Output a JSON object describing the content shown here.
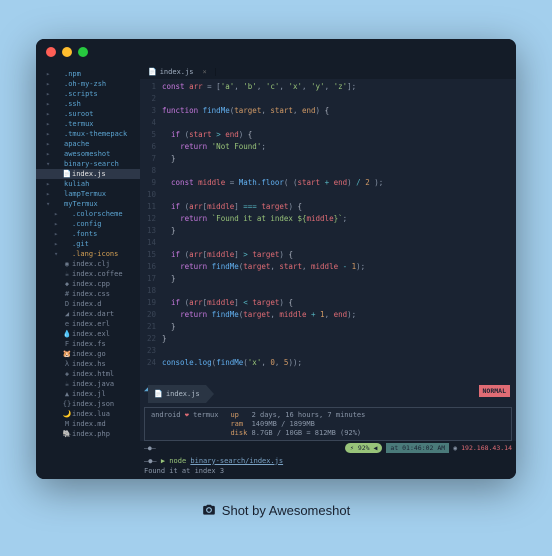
{
  "tab": {
    "icon": "📄",
    "filename": "index.js",
    "close": "×"
  },
  "sidebar": {
    "items": [
      {
        "name": ".npm",
        "type": "dir",
        "indent": 1
      },
      {
        "name": ".oh-my-zsh",
        "type": "dir",
        "indent": 1
      },
      {
        "name": ".scripts",
        "type": "dir",
        "indent": 1
      },
      {
        "name": ".ssh",
        "type": "dir",
        "indent": 1
      },
      {
        "name": ".suroot",
        "type": "dir",
        "indent": 1
      },
      {
        "name": ".termux",
        "type": "dir",
        "indent": 1
      },
      {
        "name": ".tmux-themepack",
        "type": "dir",
        "indent": 1
      },
      {
        "name": "apache",
        "type": "dir",
        "indent": 1
      },
      {
        "name": "awesomeshot",
        "type": "dir",
        "indent": 1
      },
      {
        "name": "binary-search",
        "type": "dir",
        "indent": 1,
        "open": true
      },
      {
        "name": "index.js",
        "type": "file",
        "indent": 2,
        "active": true,
        "icon": "📄"
      },
      {
        "name": "kuliah",
        "type": "dir",
        "indent": 1
      },
      {
        "name": "lampTermux",
        "type": "dir",
        "indent": 1
      },
      {
        "name": "myTermux",
        "type": "dir",
        "indent": 1,
        "open": true
      },
      {
        "name": ".colorscheme",
        "type": "dir",
        "indent": 2
      },
      {
        "name": ".config",
        "type": "dir",
        "indent": 2
      },
      {
        "name": ".fonts",
        "type": "dir",
        "indent": 2
      },
      {
        "name": ".git",
        "type": "dir",
        "indent": 2
      },
      {
        "name": ".lang-icons",
        "type": "dir",
        "indent": 2,
        "open": true,
        "orange": true
      },
      {
        "name": "index.clj",
        "type": "file",
        "indent": 2,
        "icon": "◉"
      },
      {
        "name": "index.coffee",
        "type": "file",
        "indent": 2,
        "icon": "☕"
      },
      {
        "name": "index.cpp",
        "type": "file",
        "indent": 2,
        "icon": "◆"
      },
      {
        "name": "index.css",
        "type": "file",
        "indent": 2,
        "icon": "#"
      },
      {
        "name": "index.d",
        "type": "file",
        "indent": 2,
        "icon": "D"
      },
      {
        "name": "index.dart",
        "type": "file",
        "indent": 2,
        "icon": "◢"
      },
      {
        "name": "index.erl",
        "type": "file",
        "indent": 2,
        "icon": "e"
      },
      {
        "name": "index.exl",
        "type": "file",
        "indent": 2,
        "icon": "💧"
      },
      {
        "name": "index.fs",
        "type": "file",
        "indent": 2,
        "icon": "F"
      },
      {
        "name": "index.go",
        "type": "file",
        "indent": 2,
        "icon": "🐹"
      },
      {
        "name": "index.hs",
        "type": "file",
        "indent": 2,
        "icon": "λ"
      },
      {
        "name": "index.html",
        "type": "file",
        "indent": 2,
        "icon": "◈"
      },
      {
        "name": "index.java",
        "type": "file",
        "indent": 2,
        "icon": "☕"
      },
      {
        "name": "index.jl",
        "type": "file",
        "indent": 2,
        "icon": "▲"
      },
      {
        "name": "index.json",
        "type": "file",
        "indent": 2,
        "icon": "{}"
      },
      {
        "name": "index.lua",
        "type": "file",
        "indent": 2,
        "icon": "🌙"
      },
      {
        "name": "index.md",
        "type": "file",
        "indent": 2,
        "icon": "M"
      },
      {
        "name": "index.php",
        "type": "file",
        "indent": 2,
        "icon": "🐘"
      }
    ]
  },
  "code": {
    "lines": [
      {
        "n": "1",
        "html": "<span class='kw'>const</span> <span class='var'>arr</span> = [<span class='str'>'a'</span>, <span class='str'>'b'</span>, <span class='str'>'c'</span>, <span class='str'>'x'</span>, <span class='str'>'y'</span>, <span class='str'>'z'</span>];"
      },
      {
        "n": "2",
        "html": ""
      },
      {
        "n": "3",
        "html": "<span class='kw'>function</span> <span class='fn'>findMe</span>(<span class='param'>target</span>, <span class='param'>start</span>, <span class='param'>end</span>) <span class='brace'>{</span>"
      },
      {
        "n": "4",
        "html": ""
      },
      {
        "n": "5",
        "html": "  <span class='kw'>if</span> (<span class='var'>start</span> <span class='op'>&gt;</span> <span class='var'>end</span>) <span class='brace'>{</span>"
      },
      {
        "n": "6",
        "html": "    <span class='kw'>return</span> <span class='str'>'Not Found'</span>;"
      },
      {
        "n": "7",
        "html": "  <span class='brace'>}</span>"
      },
      {
        "n": "8",
        "html": ""
      },
      {
        "n": "9",
        "html": "  <span class='kw'>const</span> <span class='var'>middle</span> = <span class='fn'>Math.floor</span>( (<span class='var'>start</span> <span class='op'>+</span> <span class='var'>end</span>) <span class='op'>/</span> <span class='num'>2</span> );"
      },
      {
        "n": "10",
        "html": ""
      },
      {
        "n": "11",
        "html": "  <span class='kw'>if</span> (<span class='var'>arr</span>[<span class='var'>middle</span>] <span class='op'>===</span> <span class='var'>target</span>) <span class='brace'>{</span>"
      },
      {
        "n": "12",
        "html": "    <span class='kw'>return</span> <span class='str'>`Found it at index ${</span><span class='var'>middle</span><span class='str'>}`</span>;"
      },
      {
        "n": "13",
        "html": "  <span class='brace'>}</span>"
      },
      {
        "n": "14",
        "html": ""
      },
      {
        "n": "15",
        "html": "  <span class='kw'>if</span> (<span class='var'>arr</span>[<span class='var'>middle</span>] <span class='op'>&gt;</span> <span class='var'>target</span>) <span class='brace'>{</span>"
      },
      {
        "n": "16",
        "html": "    <span class='kw'>return</span> <span class='fn'>findMe</span>(<span class='var'>target</span>, <span class='var'>start</span>, <span class='var'>middle</span> <span class='op'>-</span> <span class='num'>1</span>);"
      },
      {
        "n": "17",
        "html": "  <span class='brace'>}</span>"
      },
      {
        "n": "18",
        "html": ""
      },
      {
        "n": "19",
        "html": "  <span class='kw'>if</span> (<span class='var'>arr</span>[<span class='var'>middle</span>] <span class='op'>&lt;</span> <span class='var'>target</span>) <span class='brace'>{</span>"
      },
      {
        "n": "20",
        "html": "    <span class='kw'>return</span> <span class='fn'>findMe</span>(<span class='var'>target</span>, <span class='var'>middle</span> <span class='op'>+</span> <span class='num'>1</span>, <span class='var'>end</span>);"
      },
      {
        "n": "21",
        "html": "  <span class='brace'>}</span>"
      },
      {
        "n": "22",
        "html": "<span class='brace'>}</span>"
      },
      {
        "n": "23",
        "html": ""
      },
      {
        "n": "24",
        "html": "<span class='fn'>console.log</span>(<span class='fn'>findMe</span>(<span class='str'>'x'</span>, <span class='num'>0</span>, <span class='num'>5</span>));"
      }
    ]
  },
  "status": {
    "current_file_icon": "📄",
    "current_file": "index.js",
    "mode": "NORMAL",
    "motd_left": "android",
    "motd_heart": "❤",
    "motd_right": "termux",
    "up_label": "up",
    "up_val": "2 days, 16 hours, 7 minutes",
    "ram_label": "ram",
    "ram_val": "1409MB / 1899MB",
    "disk_label": "disk",
    "disk_val": "8.7GB / 10GB = 812MB (92%)"
  },
  "bottombar": {
    "left_dash": "—●—",
    "battery": "⚡ 92% ◀",
    "time": "at 01:46:02 AM",
    "extra": "◉",
    "ip": "192.168.43.14"
  },
  "terminal": {
    "prompt_dash": "—●—",
    "prompt_node": "▶ node",
    "prompt_path": "binary-search/index.js",
    "output": "Found it at index 3"
  },
  "caption": "Shot by Awesomeshot"
}
